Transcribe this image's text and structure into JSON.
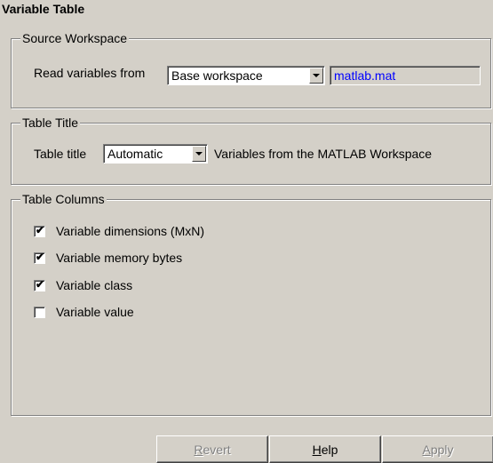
{
  "panel": {
    "title": "Variable Table"
  },
  "source": {
    "group_label": "Source Workspace",
    "read_label": "Read variables from",
    "workspace_value": "Base workspace",
    "file_value": "matlab.mat"
  },
  "table_title": {
    "group_label": "Table Title",
    "label": "Table title",
    "mode_value": "Automatic",
    "text": "Variables from the MATLAB Workspace"
  },
  "columns": {
    "group_label": "Table Columns",
    "items": [
      {
        "label": "Variable dimensions (MxN)",
        "checked": true
      },
      {
        "label": "Variable memory bytes",
        "checked": true
      },
      {
        "label": "Variable class",
        "checked": true
      },
      {
        "label": "Variable value",
        "checked": false
      }
    ]
  },
  "buttons": {
    "revert": {
      "mnemonic": "R",
      "rest": "evert",
      "enabled": false
    },
    "help": {
      "mnemonic": "H",
      "rest": "elp",
      "enabled": true
    },
    "apply": {
      "mnemonic": "A",
      "rest": "pply",
      "enabled": false
    }
  }
}
